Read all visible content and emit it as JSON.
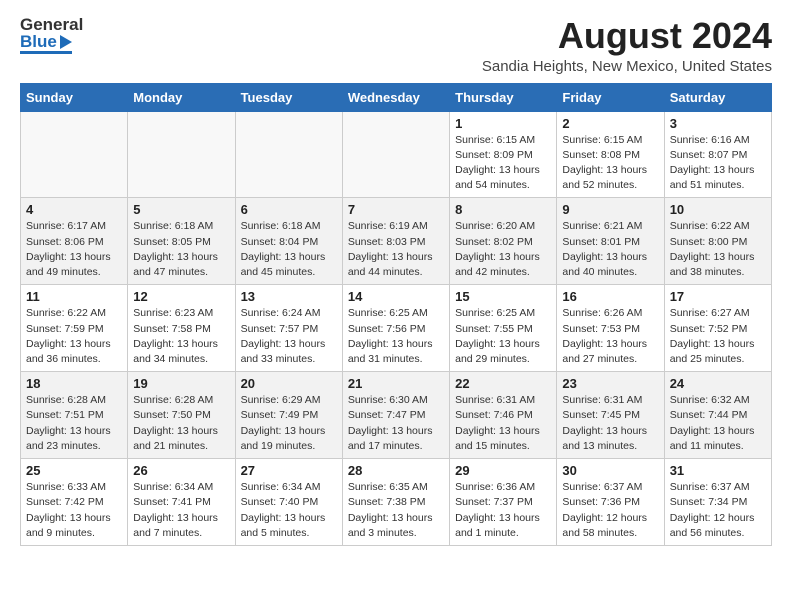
{
  "header": {
    "logo_line1": "General",
    "logo_line2": "Blue",
    "month_year": "August 2024",
    "location": "Sandia Heights, New Mexico, United States"
  },
  "calendar": {
    "days_of_week": [
      "Sunday",
      "Monday",
      "Tuesday",
      "Wednesday",
      "Thursday",
      "Friday",
      "Saturday"
    ],
    "weeks": [
      [
        {
          "day": "",
          "info": ""
        },
        {
          "day": "",
          "info": ""
        },
        {
          "day": "",
          "info": ""
        },
        {
          "day": "",
          "info": ""
        },
        {
          "day": "1",
          "info": "Sunrise: 6:15 AM\nSunset: 8:09 PM\nDaylight: 13 hours\nand 54 minutes."
        },
        {
          "day": "2",
          "info": "Sunrise: 6:15 AM\nSunset: 8:08 PM\nDaylight: 13 hours\nand 52 minutes."
        },
        {
          "day": "3",
          "info": "Sunrise: 6:16 AM\nSunset: 8:07 PM\nDaylight: 13 hours\nand 51 minutes."
        }
      ],
      [
        {
          "day": "4",
          "info": "Sunrise: 6:17 AM\nSunset: 8:06 PM\nDaylight: 13 hours\nand 49 minutes."
        },
        {
          "day": "5",
          "info": "Sunrise: 6:18 AM\nSunset: 8:05 PM\nDaylight: 13 hours\nand 47 minutes."
        },
        {
          "day": "6",
          "info": "Sunrise: 6:18 AM\nSunset: 8:04 PM\nDaylight: 13 hours\nand 45 minutes."
        },
        {
          "day": "7",
          "info": "Sunrise: 6:19 AM\nSunset: 8:03 PM\nDaylight: 13 hours\nand 44 minutes."
        },
        {
          "day": "8",
          "info": "Sunrise: 6:20 AM\nSunset: 8:02 PM\nDaylight: 13 hours\nand 42 minutes."
        },
        {
          "day": "9",
          "info": "Sunrise: 6:21 AM\nSunset: 8:01 PM\nDaylight: 13 hours\nand 40 minutes."
        },
        {
          "day": "10",
          "info": "Sunrise: 6:22 AM\nSunset: 8:00 PM\nDaylight: 13 hours\nand 38 minutes."
        }
      ],
      [
        {
          "day": "11",
          "info": "Sunrise: 6:22 AM\nSunset: 7:59 PM\nDaylight: 13 hours\nand 36 minutes."
        },
        {
          "day": "12",
          "info": "Sunrise: 6:23 AM\nSunset: 7:58 PM\nDaylight: 13 hours\nand 34 minutes."
        },
        {
          "day": "13",
          "info": "Sunrise: 6:24 AM\nSunset: 7:57 PM\nDaylight: 13 hours\nand 33 minutes."
        },
        {
          "day": "14",
          "info": "Sunrise: 6:25 AM\nSunset: 7:56 PM\nDaylight: 13 hours\nand 31 minutes."
        },
        {
          "day": "15",
          "info": "Sunrise: 6:25 AM\nSunset: 7:55 PM\nDaylight: 13 hours\nand 29 minutes."
        },
        {
          "day": "16",
          "info": "Sunrise: 6:26 AM\nSunset: 7:53 PM\nDaylight: 13 hours\nand 27 minutes."
        },
        {
          "day": "17",
          "info": "Sunrise: 6:27 AM\nSunset: 7:52 PM\nDaylight: 13 hours\nand 25 minutes."
        }
      ],
      [
        {
          "day": "18",
          "info": "Sunrise: 6:28 AM\nSunset: 7:51 PM\nDaylight: 13 hours\nand 23 minutes."
        },
        {
          "day": "19",
          "info": "Sunrise: 6:28 AM\nSunset: 7:50 PM\nDaylight: 13 hours\nand 21 minutes."
        },
        {
          "day": "20",
          "info": "Sunrise: 6:29 AM\nSunset: 7:49 PM\nDaylight: 13 hours\nand 19 minutes."
        },
        {
          "day": "21",
          "info": "Sunrise: 6:30 AM\nSunset: 7:47 PM\nDaylight: 13 hours\nand 17 minutes."
        },
        {
          "day": "22",
          "info": "Sunrise: 6:31 AM\nSunset: 7:46 PM\nDaylight: 13 hours\nand 15 minutes."
        },
        {
          "day": "23",
          "info": "Sunrise: 6:31 AM\nSunset: 7:45 PM\nDaylight: 13 hours\nand 13 minutes."
        },
        {
          "day": "24",
          "info": "Sunrise: 6:32 AM\nSunset: 7:44 PM\nDaylight: 13 hours\nand 11 minutes."
        }
      ],
      [
        {
          "day": "25",
          "info": "Sunrise: 6:33 AM\nSunset: 7:42 PM\nDaylight: 13 hours\nand 9 minutes."
        },
        {
          "day": "26",
          "info": "Sunrise: 6:34 AM\nSunset: 7:41 PM\nDaylight: 13 hours\nand 7 minutes."
        },
        {
          "day": "27",
          "info": "Sunrise: 6:34 AM\nSunset: 7:40 PM\nDaylight: 13 hours\nand 5 minutes."
        },
        {
          "day": "28",
          "info": "Sunrise: 6:35 AM\nSunset: 7:38 PM\nDaylight: 13 hours\nand 3 minutes."
        },
        {
          "day": "29",
          "info": "Sunrise: 6:36 AM\nSunset: 7:37 PM\nDaylight: 13 hours\nand 1 minute."
        },
        {
          "day": "30",
          "info": "Sunrise: 6:37 AM\nSunset: 7:36 PM\nDaylight: 12 hours\nand 58 minutes."
        },
        {
          "day": "31",
          "info": "Sunrise: 6:37 AM\nSunset: 7:34 PM\nDaylight: 12 hours\nand 56 minutes."
        }
      ]
    ]
  }
}
